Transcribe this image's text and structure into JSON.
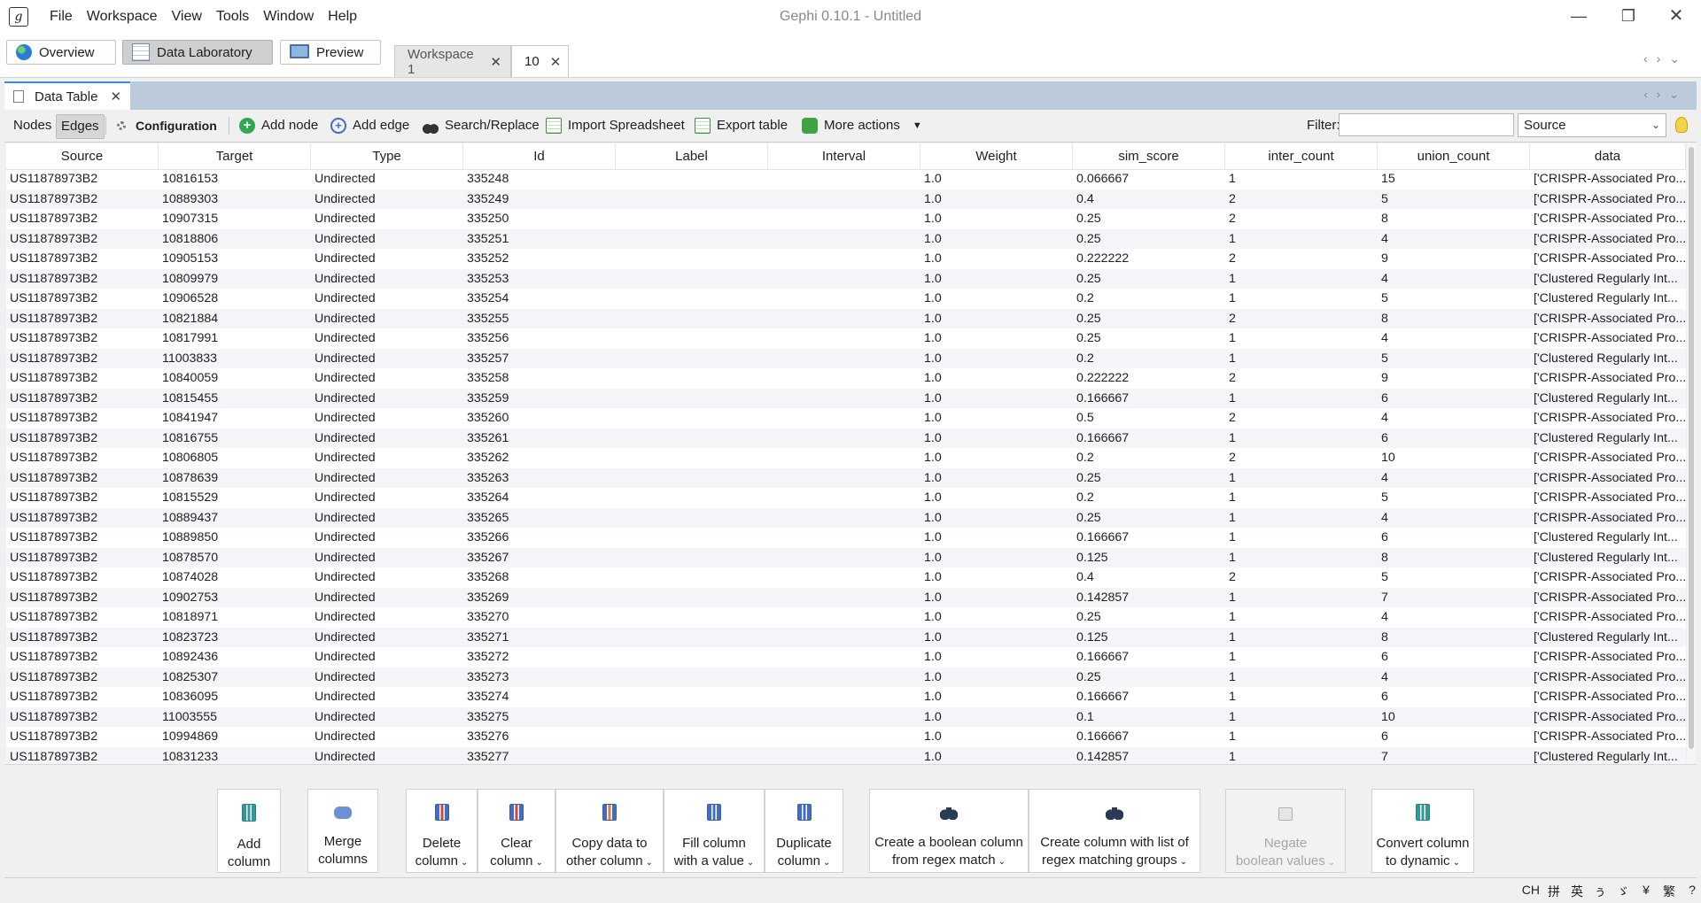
{
  "window": {
    "title": "Gephi 0.10.1 - Untitled",
    "menu": [
      "File",
      "Workspace",
      "View",
      "Tools",
      "Window",
      "Help"
    ],
    "controls": {
      "minimize": "—",
      "maximize": "❐",
      "close": "✕"
    }
  },
  "perspectives": {
    "overview": "Overview",
    "data_lab": "Data Laboratory",
    "preview": "Preview"
  },
  "workspace_tabs": {
    "tab1": "Workspace 1",
    "tab2": "10",
    "close": "✕"
  },
  "panel": {
    "tab_label": "Data Table",
    "close": "✕"
  },
  "toolbar": {
    "nodes": "Nodes",
    "edges": "Edges",
    "configuration": "Configuration",
    "add_node": "Add node",
    "add_edge": "Add edge",
    "search_replace": "Search/Replace",
    "import_spreadsheet": "Import Spreadsheet",
    "export_table": "Export table",
    "more_actions": "More actions",
    "filter_label": "Filter:",
    "filter_value": "",
    "filter_column": "Source"
  },
  "table": {
    "columns": [
      "Source",
      "Target",
      "Type",
      "Id",
      "Label",
      "Interval",
      "Weight",
      "sim_score",
      "inter_count",
      "union_count",
      "data"
    ],
    "rows": [
      [
        "US11878973B2",
        "10816153",
        "Undirected",
        "335248",
        "",
        "",
        "1.0",
        "0.066667",
        "1",
        "15",
        "['CRISPR-Associated Pro..."
      ],
      [
        "US11878973B2",
        "10889303",
        "Undirected",
        "335249",
        "",
        "",
        "1.0",
        "0.4",
        "2",
        "5",
        "['CRISPR-Associated Pro..."
      ],
      [
        "US11878973B2",
        "10907315",
        "Undirected",
        "335250",
        "",
        "",
        "1.0",
        "0.25",
        "2",
        "8",
        "['CRISPR-Associated Pro..."
      ],
      [
        "US11878973B2",
        "10818806",
        "Undirected",
        "335251",
        "",
        "",
        "1.0",
        "0.25",
        "1",
        "4",
        "['CRISPR-Associated Pro..."
      ],
      [
        "US11878973B2",
        "10905153",
        "Undirected",
        "335252",
        "",
        "",
        "1.0",
        "0.222222",
        "2",
        "9",
        "['CRISPR-Associated Pro..."
      ],
      [
        "US11878973B2",
        "10809979",
        "Undirected",
        "335253",
        "",
        "",
        "1.0",
        "0.25",
        "1",
        "4",
        "['Clustered Regularly Int..."
      ],
      [
        "US11878973B2",
        "10906528",
        "Undirected",
        "335254",
        "",
        "",
        "1.0",
        "0.2",
        "1",
        "5",
        "['Clustered Regularly Int..."
      ],
      [
        "US11878973B2",
        "10821884",
        "Undirected",
        "335255",
        "",
        "",
        "1.0",
        "0.25",
        "2",
        "8",
        "['CRISPR-Associated Pro..."
      ],
      [
        "US11878973B2",
        "10817991",
        "Undirected",
        "335256",
        "",
        "",
        "1.0",
        "0.25",
        "1",
        "4",
        "['CRISPR-Associated Pro..."
      ],
      [
        "US11878973B2",
        "11003833",
        "Undirected",
        "335257",
        "",
        "",
        "1.0",
        "0.2",
        "1",
        "5",
        "['Clustered Regularly Int..."
      ],
      [
        "US11878973B2",
        "10840059",
        "Undirected",
        "335258",
        "",
        "",
        "1.0",
        "0.222222",
        "2",
        "9",
        "['CRISPR-Associated Pro..."
      ],
      [
        "US11878973B2",
        "10815455",
        "Undirected",
        "335259",
        "",
        "",
        "1.0",
        "0.166667",
        "1",
        "6",
        "['Clustered Regularly Int..."
      ],
      [
        "US11878973B2",
        "10841947",
        "Undirected",
        "335260",
        "",
        "",
        "1.0",
        "0.5",
        "2",
        "4",
        "['CRISPR-Associated Pro..."
      ],
      [
        "US11878973B2",
        "10816755",
        "Undirected",
        "335261",
        "",
        "",
        "1.0",
        "0.166667",
        "1",
        "6",
        "['Clustered Regularly Int..."
      ],
      [
        "US11878973B2",
        "10806805",
        "Undirected",
        "335262",
        "",
        "",
        "1.0",
        "0.2",
        "2",
        "10",
        "['CRISPR-Associated Pro..."
      ],
      [
        "US11878973B2",
        "10878639",
        "Undirected",
        "335263",
        "",
        "",
        "1.0",
        "0.25",
        "1",
        "4",
        "['CRISPR-Associated Pro..."
      ],
      [
        "US11878973B2",
        "10815529",
        "Undirected",
        "335264",
        "",
        "",
        "1.0",
        "0.2",
        "1",
        "5",
        "['CRISPR-Associated Pro..."
      ],
      [
        "US11878973B2",
        "10889437",
        "Undirected",
        "335265",
        "",
        "",
        "1.0",
        "0.25",
        "1",
        "4",
        "['CRISPR-Associated Pro..."
      ],
      [
        "US11878973B2",
        "10889850",
        "Undirected",
        "335266",
        "",
        "",
        "1.0",
        "0.166667",
        "1",
        "6",
        "['Clustered Regularly Int..."
      ],
      [
        "US11878973B2",
        "10878570",
        "Undirected",
        "335267",
        "",
        "",
        "1.0",
        "0.125",
        "1",
        "8",
        "['Clustered Regularly Int..."
      ],
      [
        "US11878973B2",
        "10874028",
        "Undirected",
        "335268",
        "",
        "",
        "1.0",
        "0.4",
        "2",
        "5",
        "['CRISPR-Associated Pro..."
      ],
      [
        "US11878973B2",
        "10902753",
        "Undirected",
        "335269",
        "",
        "",
        "1.0",
        "0.142857",
        "1",
        "7",
        "['CRISPR-Associated Pro..."
      ],
      [
        "US11878973B2",
        "10818971",
        "Undirected",
        "335270",
        "",
        "",
        "1.0",
        "0.25",
        "1",
        "4",
        "['CRISPR-Associated Pro..."
      ],
      [
        "US11878973B2",
        "10823723",
        "Undirected",
        "335271",
        "",
        "",
        "1.0",
        "0.125",
        "1",
        "8",
        "['Clustered Regularly Int..."
      ],
      [
        "US11878973B2",
        "10892436",
        "Undirected",
        "335272",
        "",
        "",
        "1.0",
        "0.166667",
        "1",
        "6",
        "['CRISPR-Associated Pro..."
      ],
      [
        "US11878973B2",
        "10825307",
        "Undirected",
        "335273",
        "",
        "",
        "1.0",
        "0.25",
        "1",
        "4",
        "['CRISPR-Associated Pro..."
      ],
      [
        "US11878973B2",
        "10836095",
        "Undirected",
        "335274",
        "",
        "",
        "1.0",
        "0.166667",
        "1",
        "6",
        "['CRISPR-Associated Pro..."
      ],
      [
        "US11878973B2",
        "11003555",
        "Undirected",
        "335275",
        "",
        "",
        "1.0",
        "0.1",
        "1",
        "10",
        "['CRISPR-Associated Pro..."
      ],
      [
        "US11878973B2",
        "10994869",
        "Undirected",
        "335276",
        "",
        "",
        "1.0",
        "0.166667",
        "1",
        "6",
        "['CRISPR-Associated Pro..."
      ],
      [
        "US11878973B2",
        "10831233",
        "Undirected",
        "335277",
        "",
        "",
        "1.0",
        "0.142857",
        "1",
        "7",
        "['Clustered Regularly Int..."
      ]
    ]
  },
  "column_actions": [
    {
      "name": "add-column-button",
      "line1": "Add",
      "line2": "column",
      "dropdown": false,
      "enabled": true,
      "icon": "column-icon"
    },
    {
      "name": "merge-columns-button",
      "line1": "Merge",
      "line2": "columns",
      "dropdown": false,
      "enabled": true,
      "icon": "merge-icon"
    },
    {
      "name": "delete-column-button",
      "line1": "Delete",
      "line2": "column",
      "dropdown": true,
      "enabled": true,
      "icon": "delete-column-icon"
    },
    {
      "name": "clear-column-button",
      "line1": "Clear",
      "line2": "column",
      "dropdown": true,
      "enabled": true,
      "icon": "clear-column-icon"
    },
    {
      "name": "copy-data-button",
      "line1": "Copy data to",
      "line2": "other column",
      "dropdown": true,
      "enabled": true,
      "icon": "copy-column-icon"
    },
    {
      "name": "fill-column-button",
      "line1": "Fill column",
      "line2": "with a value",
      "dropdown": true,
      "enabled": true,
      "icon": "fill-column-icon"
    },
    {
      "name": "duplicate-column-button",
      "line1": "Duplicate",
      "line2": "column",
      "dropdown": true,
      "enabled": true,
      "icon": "duplicate-column-icon"
    },
    {
      "name": "boolean-regex-button",
      "line1": "Create a boolean column",
      "line2": "from regex match",
      "dropdown": true,
      "enabled": true,
      "icon": "binoculars-icon"
    },
    {
      "name": "regex-groups-button",
      "line1": "Create column with list of",
      "line2": "regex matching groups",
      "dropdown": true,
      "enabled": true,
      "icon": "binoculars-icon"
    },
    {
      "name": "negate-boolean-button",
      "line1": "Negate",
      "line2": "boolean values",
      "dropdown": true,
      "enabled": false,
      "icon": "negate-icon"
    },
    {
      "name": "convert-dynamic-button",
      "line1": "Convert column",
      "line2": "to dynamic",
      "dropdown": true,
      "enabled": true,
      "icon": "convert-column-icon"
    }
  ],
  "status": {
    "ime": [
      "CH",
      "拼",
      "英",
      "ぅ",
      "ゞ",
      "¥",
      "繁",
      "?"
    ]
  }
}
